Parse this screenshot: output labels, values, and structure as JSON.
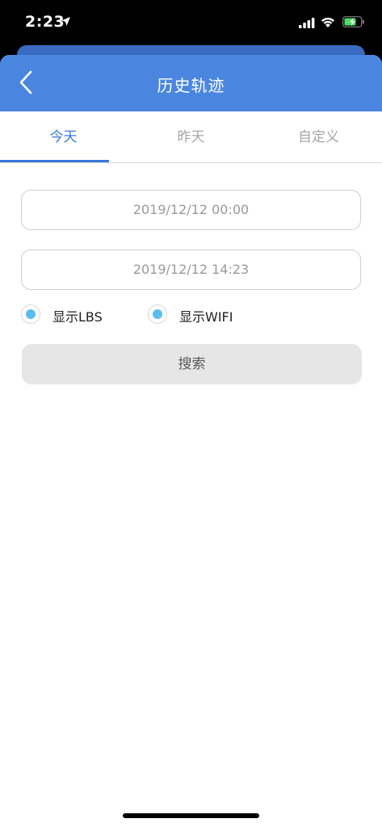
{
  "status_bar": {
    "time": "2:23",
    "location_icon": "location-arrow-icon",
    "signal_icon": "cellular-signal-icon",
    "wifi_icon": "wifi-icon",
    "battery_icon": "battery-charging-icon",
    "battery_color": "#4cd964"
  },
  "nav": {
    "title": "历史轨迹",
    "back_icon": "chevron-left-icon",
    "background_color": "#4a86e0"
  },
  "tabs": [
    {
      "label": "今天",
      "active": true
    },
    {
      "label": "昨天",
      "active": false
    },
    {
      "label": "自定义",
      "active": false
    }
  ],
  "form": {
    "start_time": "2019/12/12 00:00",
    "end_time": "2019/12/12 14:23",
    "options": [
      {
        "label": "显示LBS",
        "selected": true
      },
      {
        "label": "显示WIFI",
        "selected": true
      }
    ],
    "search_label": "搜索"
  },
  "colors": {
    "accent": "#3a78d8",
    "radio_dot": "#5bbcf0",
    "button_bg": "#e6e6e6"
  }
}
